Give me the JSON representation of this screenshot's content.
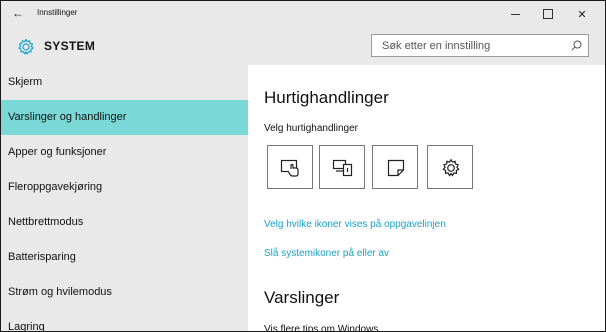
{
  "titlebar": {
    "back_glyph": "←",
    "title": "Innstillinger",
    "close_glyph": "✕"
  },
  "header": {
    "section_title": "SYSTEM",
    "search_placeholder": "Søk etter en innstilling",
    "icon": "gear-icon"
  },
  "sidebar": {
    "items": [
      {
        "label": "Skjerm"
      },
      {
        "label": "Varslinger og handlinger"
      },
      {
        "label": "Apper og funksjoner"
      },
      {
        "label": "Fleroppgavekjøring"
      },
      {
        "label": "Nettbrettmodus"
      },
      {
        "label": "Batterisparing"
      },
      {
        "label": "Strøm og hvilemodus"
      },
      {
        "label": "Lagring"
      }
    ]
  },
  "main": {
    "quick_heading": "Hurtighandlinger",
    "quick_sub": "Velg hurtighandlinger",
    "tiles": [
      "tablet-mode-icon",
      "project-icon",
      "note-icon",
      "settings-gear-icon"
    ],
    "link_icons": "Velg hvilke ikoner vises på oppgavelinjen",
    "link_system_icons": "Slå systemikoner på eller av",
    "notif_heading": "Varslinger",
    "notif_sub": "Vis flere tips om Windows"
  },
  "colors": {
    "accent": "#7ad9d6",
    "link": "#1aa3c6",
    "chrome": "#e9e9e9"
  }
}
